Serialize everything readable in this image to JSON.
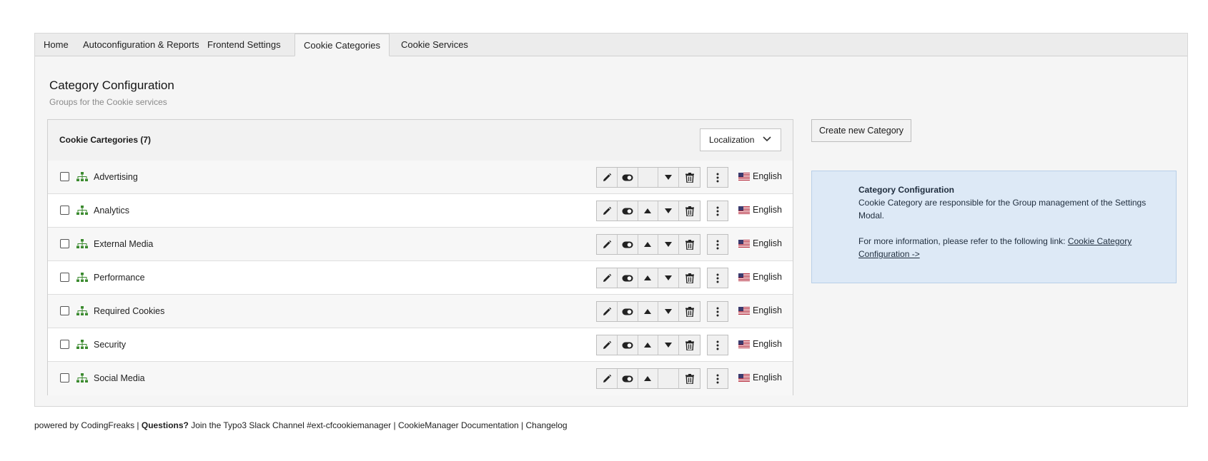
{
  "tabs": [
    {
      "label": "Home"
    },
    {
      "label": "Autoconfiguration & Reports"
    },
    {
      "label": "Frontend Settings"
    },
    {
      "label": "Cookie Categories"
    },
    {
      "label": "Cookie Services"
    }
  ],
  "header": {
    "title": "Category Configuration",
    "subtitle": "Groups for the Cookie services"
  },
  "panel": {
    "title": "Cookie Cartegories (7)",
    "localization_label": "Localization"
  },
  "rows": [
    {
      "title": "Advertising",
      "language": "English"
    },
    {
      "title": "Analytics",
      "language": "English"
    },
    {
      "title": "External Media",
      "language": "English"
    },
    {
      "title": "Performance",
      "language": "English"
    },
    {
      "title": "Required Cookies",
      "language": "English"
    },
    {
      "title": "Security",
      "language": "English"
    },
    {
      "title": "Social Media",
      "language": "English"
    }
  ],
  "create_button": "Create new Category",
  "info": {
    "title": "Category Configuration",
    "text": "Cookie Category are responsible for the Group management of the Settings Modal.",
    "more_text": "For more information, please refer to the following link: ",
    "link": "Cookie Category Configuration ->"
  },
  "footer": {
    "powered": "powered by CodingFreaks | ",
    "questions": "Questions?",
    "slack": " Join the Typo3 Slack Channel #ext-cfcookiemanager",
    "sep1": " | ",
    "docs": "CookieManager Documentation",
    "sep2": " | ",
    "changelog": "Changelog"
  },
  "colors": {
    "category_icon": "#3a8a2e",
    "info_background": "#dde9f6"
  }
}
